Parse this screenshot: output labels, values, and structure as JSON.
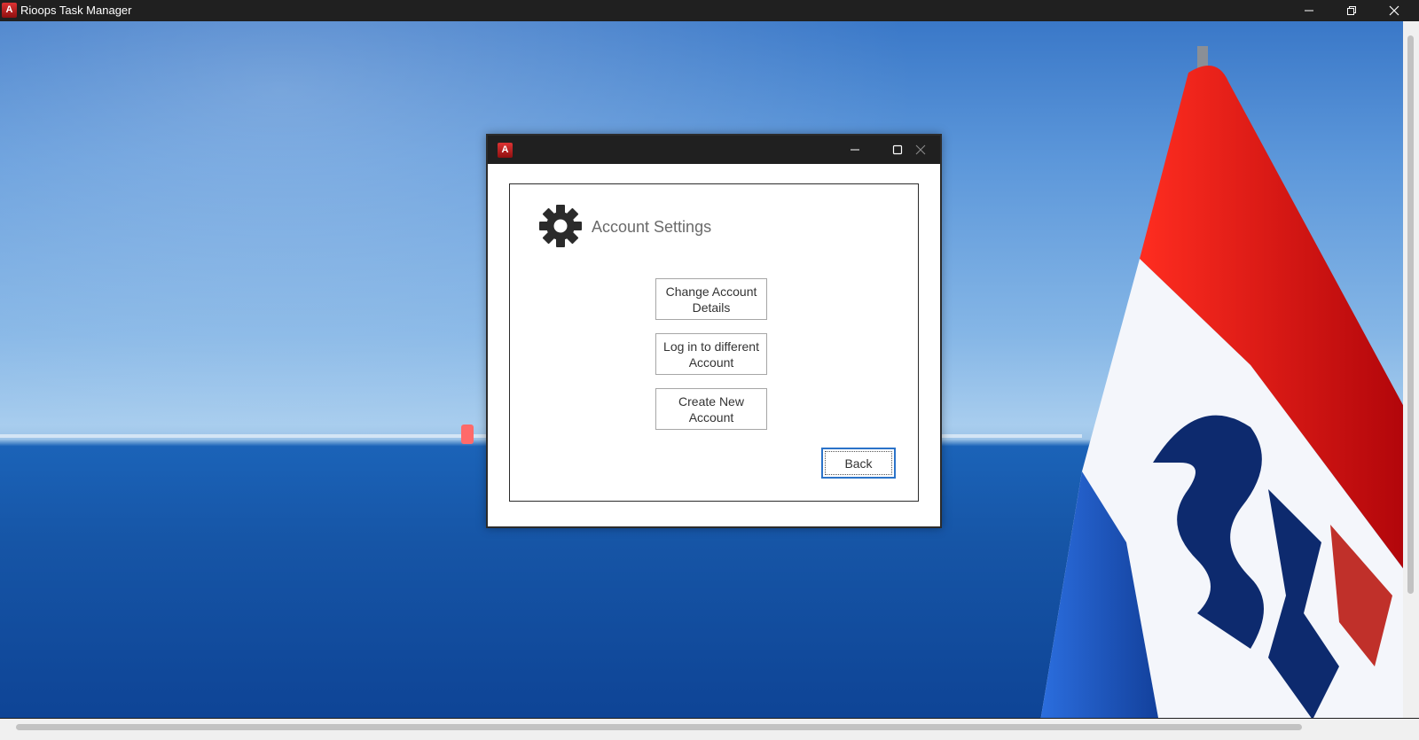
{
  "window": {
    "title": "Rioops Task Manager",
    "logo_letter": "A",
    "controls": [
      "minimize-icon",
      "restore-icon",
      "close-icon"
    ]
  },
  "dialog": {
    "logo_letter": "A",
    "controls": [
      "minimize-icon",
      "maximize-icon",
      "close-icon"
    ],
    "heading": "Account Settings",
    "heading_icon": "gear-icon",
    "buttons": {
      "change_account_details": "Change Account\nDetails",
      "log_in_different": "Log in to  different\nAccount",
      "create_new_account": "Create New\nAccount",
      "back": "Back"
    }
  },
  "colors": {
    "titlebar": "#202020",
    "accent_focus": "#2b73c9",
    "logo_red": "#c62828"
  }
}
